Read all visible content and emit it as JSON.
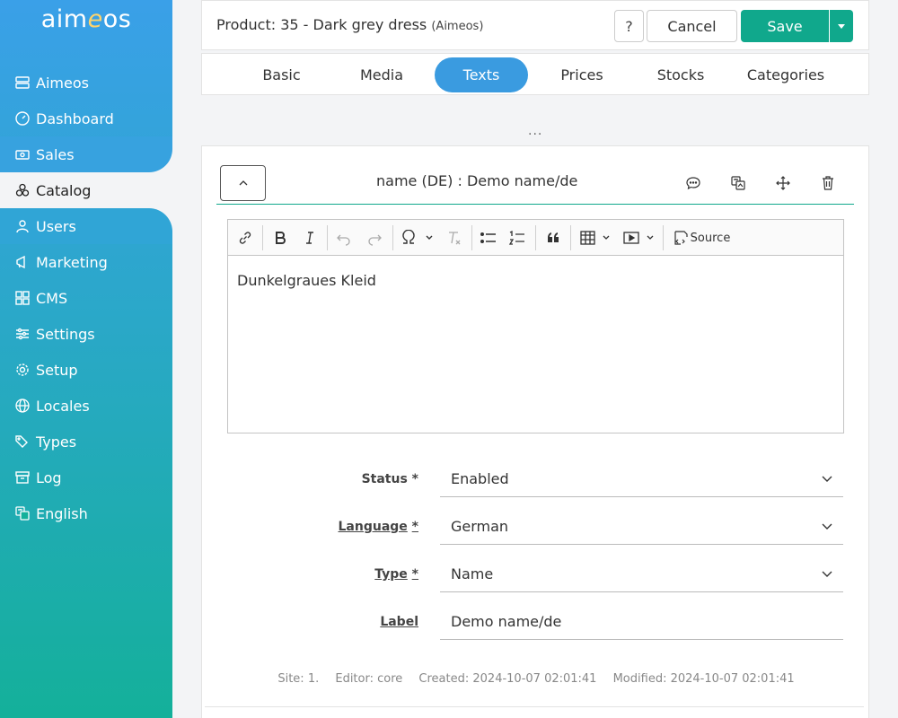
{
  "brand": {
    "logo_pre": "aim",
    "logo_e": "e",
    "logo_post": "os"
  },
  "sidebar": {
    "items": [
      {
        "label": "Aimeos",
        "icon": "server-icon"
      },
      {
        "label": "Dashboard",
        "icon": "gauge-icon"
      },
      {
        "label": "Sales",
        "icon": "cash-icon"
      },
      {
        "label": "Catalog",
        "icon": "boxes-icon",
        "active": true
      },
      {
        "label": "Users",
        "icon": "person-icon"
      },
      {
        "label": "Marketing",
        "icon": "megaphone-icon"
      },
      {
        "label": "CMS",
        "icon": "grid-icon"
      },
      {
        "label": "Settings",
        "icon": "sliders-icon"
      },
      {
        "label": "Setup",
        "icon": "gear-icon"
      },
      {
        "label": "Locales",
        "icon": "globe-icon"
      },
      {
        "label": "Types",
        "icon": "tags-icon"
      },
      {
        "label": "Log",
        "icon": "archive-icon"
      },
      {
        "label": "English",
        "icon": "translate-icon"
      }
    ]
  },
  "header": {
    "title": "Product: 35 - Dark grey dress",
    "site": "(Aimeos)",
    "help_label": "?",
    "cancel_label": "Cancel",
    "save_label": "Save"
  },
  "tabs": [
    {
      "label": "Basic"
    },
    {
      "label": "Media"
    },
    {
      "label": "Texts",
      "active": true
    },
    {
      "label": "Prices"
    },
    {
      "label": "Stocks"
    },
    {
      "label": "Categories"
    }
  ],
  "more_indicator": "...",
  "text_item": {
    "title": "name (DE) : Demo name/de",
    "editor": {
      "source_label": "Source",
      "content": "Dunkelgraues Kleid"
    },
    "fields": {
      "status": {
        "label": "Status *",
        "value": "Enabled"
      },
      "language": {
        "label": "Language",
        "required": "*",
        "value": "German"
      },
      "type": {
        "label": "Type",
        "required": "*",
        "value": "Name"
      },
      "label": {
        "label": "Label",
        "value": "Demo name/de"
      }
    },
    "meta": {
      "site": "Site: 1.",
      "editor": "Editor: core",
      "created": "Created: 2024-10-07 02:01:41",
      "modified": "Modified: 2024-10-07 02:01:41"
    }
  },
  "colors": {
    "accent": "#3a9be0",
    "save": "#10a88c",
    "sidebar_top": "#3aa0e8",
    "sidebar_bottom": "#14b09a"
  }
}
